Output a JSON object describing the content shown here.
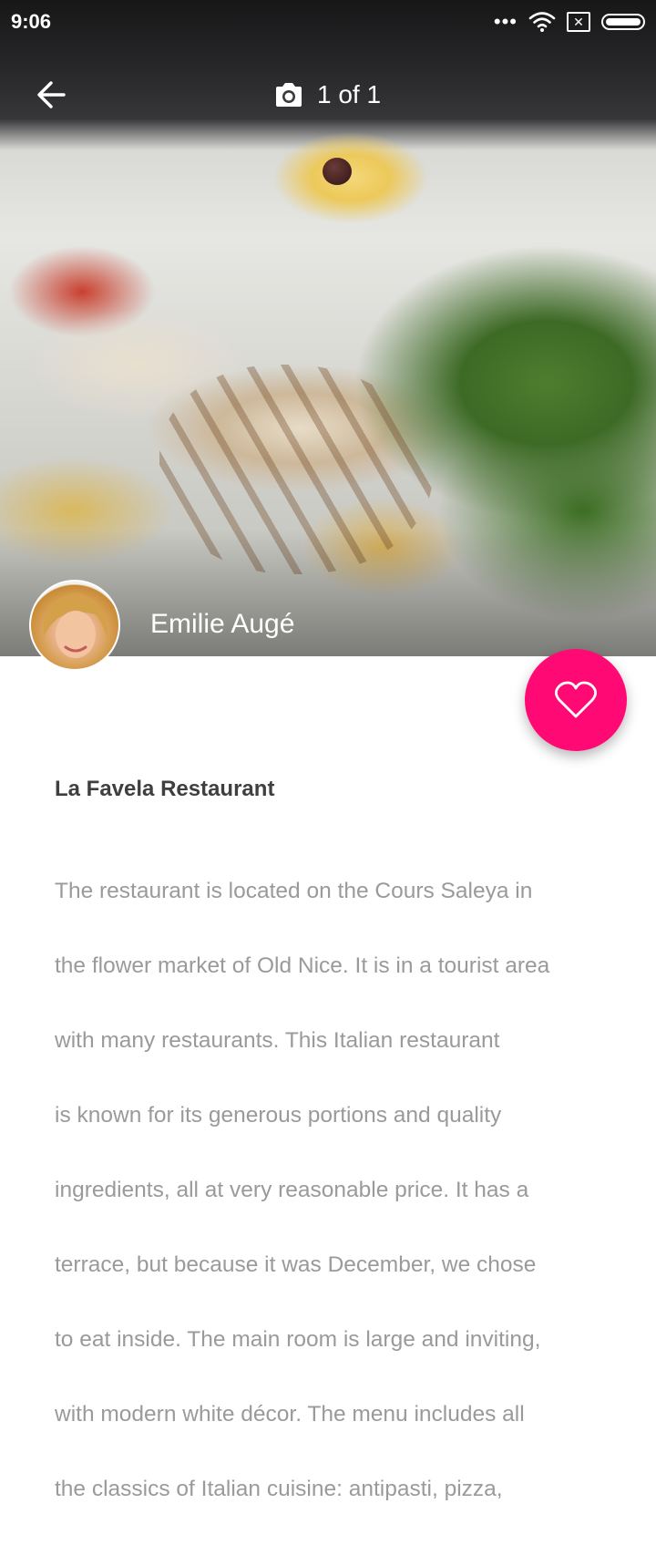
{
  "status_bar": {
    "time": "9:06",
    "icons": [
      "dots-icon",
      "wifi-icon",
      "sim-x-icon",
      "battery-icon"
    ],
    "sim_glyph": "✕"
  },
  "toolbar": {
    "back_icon": "arrow-left-icon",
    "camera_icon": "camera-icon",
    "photo_counter": "1 of 1"
  },
  "author": {
    "name": "Emilie Augé"
  },
  "favorite": {
    "icon": "heart-outline-icon",
    "color": "#ff0a74"
  },
  "article": {
    "title": "La Favela Restaurant",
    "lines": [
      "The restaurant is located on the Cours Saleya in",
      "the flower market of Old Nice. It is in a tourist area",
      "with many restaurants. This Italian restaurant",
      "is known for its generous portions and quality",
      "ingredients, all at very reasonable price. It has a",
      "terrace, but because it was December, we chose",
      "to eat inside. The main room is large and inviting,",
      "with modern white décor. The menu includes all",
      "the classics of Italian cuisine: antipasti, pizza,"
    ]
  }
}
